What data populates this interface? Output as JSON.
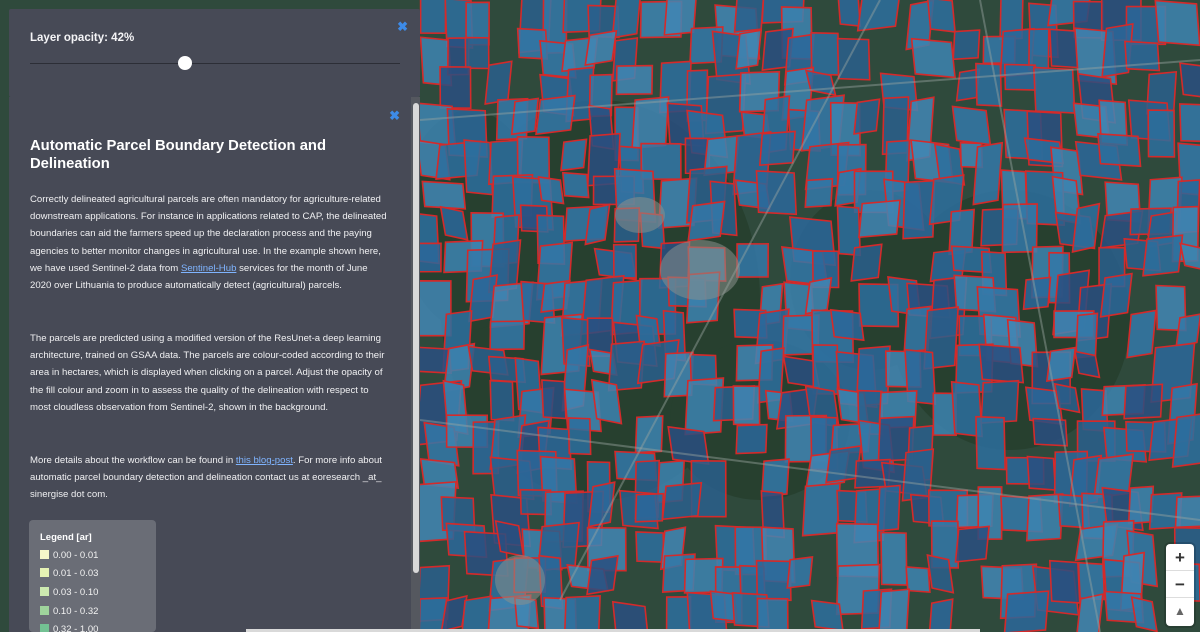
{
  "opacity": {
    "label": "Layer opacity: 42%",
    "value_percent": 42,
    "close_glyph": "✖"
  },
  "info": {
    "close_glyph": "✖",
    "title": "Automatic Parcel Boundary Detection and Delineation",
    "paragraph1": {
      "before_link": "Correctly delineated agricultural parcels are often mandatory for agriculture-related downstream applications. For instance in applications related to CAP, the delineated boundaries can aid the farmers speed up the declaration process and the paying agencies to better monitor changes in agricultural use. In the example shown here, we have used Sentinel-2 data from ",
      "link": "Sentinel-Hub",
      "after_link": " services for the month of June 2020 over Lithuania to produce automatically detect (agricultural) parcels."
    },
    "paragraph2": "The parcels are predicted using a modified version of the ResUnet-a deep learning architecture, trained on GSAA data. The parcels are colour-coded according to their area in hectares, which is displayed when clicking on a parcel. Adjust the opacity of the fill colour and zoom in to assess the quality of the delineation with respect to most cloudless observation from Sentinel-2, shown in the background.",
    "paragraph3": {
      "before_link": "More details about the workflow can be found in ",
      "link": "this blog-post",
      "after_link": ". For more info about automatic parcel boundary detection and delineation contact us at eoresearch _at_ sinergise dot com."
    }
  },
  "legend": {
    "title": "Legend [ar]",
    "items": [
      {
        "label": "0.00 - 0.01",
        "color": "#f6f7c9"
      },
      {
        "label": "0.01 - 0.03",
        "color": "#e6f3b4"
      },
      {
        "label": "0.03 - 0.10",
        "color": "#cdeab0"
      },
      {
        "label": "0.10 - 0.32",
        "color": "#9fd49c"
      },
      {
        "label": "0.32 - 1.00",
        "color": "#73c193"
      }
    ]
  },
  "zoom": {
    "zoom_in": "+",
    "zoom_out": "−",
    "compass": "▲"
  },
  "colors": {
    "panel_bg": "#474a56",
    "parcel_fill": "#2d6e9e",
    "parcel_boundary": "#d42a2a",
    "link": "#7fb4ff",
    "close_icon": "#3d8be8"
  }
}
